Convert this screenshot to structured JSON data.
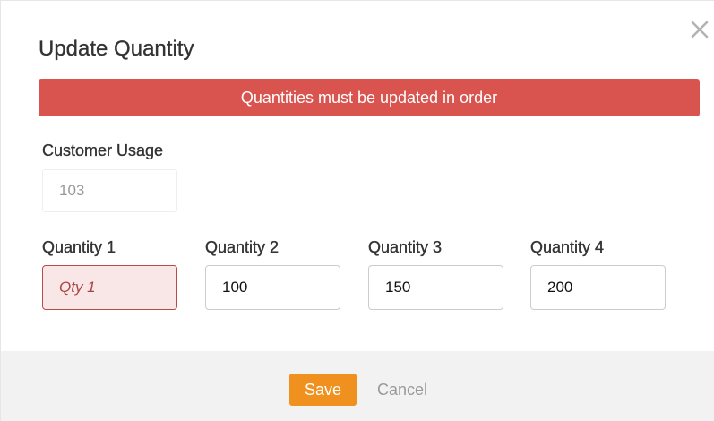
{
  "modal": {
    "title": "Update Quantity",
    "close_icon": "close-icon",
    "alert_message": "Quantities must be updated in order",
    "colors": {
      "alert_bg": "#d9534f",
      "error_input_bg": "#f9e6e6",
      "error_input_border": "#b94a48",
      "save_button_bg": "#f0901e",
      "footer_bg": "#f2f2f2"
    }
  },
  "customer_usage": {
    "label": "Customer Usage",
    "value": "103"
  },
  "quantities": [
    {
      "label": "Quantity 1",
      "value": "",
      "placeholder": "Qty 1",
      "state": "error"
    },
    {
      "label": "Quantity 2",
      "value": "100",
      "placeholder": ""
    },
    {
      "label": "Quantity 3",
      "value": "150",
      "placeholder": ""
    },
    {
      "label": "Quantity 4",
      "value": "200",
      "placeholder": ""
    }
  ],
  "footer": {
    "save_label": "Save",
    "cancel_label": "Cancel"
  }
}
